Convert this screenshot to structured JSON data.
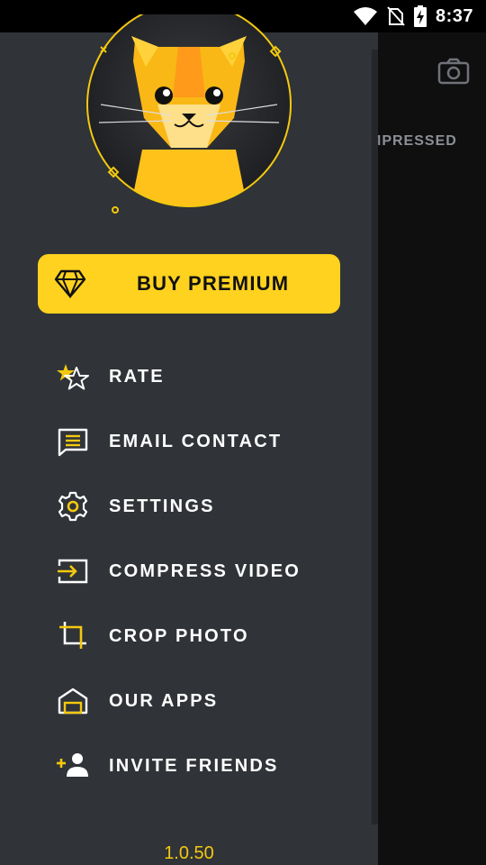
{
  "status_bar": {
    "time": "8:37",
    "icons": [
      "wifi-icon",
      "no-sim-icon",
      "battery-charging-icon"
    ]
  },
  "background_app": {
    "tab_label": "MPRESSED",
    "icons": [
      "camera-icon"
    ]
  },
  "drawer": {
    "logo": "cat-logo",
    "premium_button": {
      "label": "BUY PREMIUM",
      "icon": "diamond-icon"
    },
    "menu": [
      {
        "label": "RATE",
        "icon": "stars-icon"
      },
      {
        "label": "EMAIL CONTACT",
        "icon": "message-icon"
      },
      {
        "label": "SETTINGS",
        "icon": "gear-icon"
      },
      {
        "label": "COMPRESS VIDEO",
        "icon": "input-arrow-icon"
      },
      {
        "label": "CROP PHOTO",
        "icon": "crop-icon"
      },
      {
        "label": "OUR APPS",
        "icon": "apps-house-icon"
      },
      {
        "label": "INVITE FRIENDS",
        "icon": "add-person-icon"
      }
    ],
    "version": "1.0.50"
  },
  "colors": {
    "accent": "#ffd21f",
    "drawer_bg": "#303338",
    "text": "#ffffff",
    "version_text": "#f3c90f"
  }
}
